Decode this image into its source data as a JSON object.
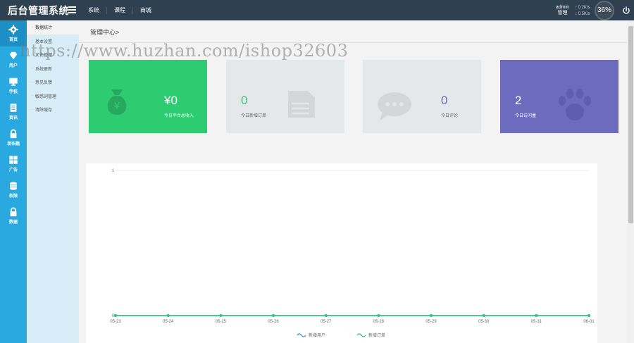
{
  "header": {
    "title": "后台管理系统",
    "nav": [
      "系统",
      "课程",
      "商城"
    ],
    "admin_name": "admin",
    "admin_role": "管理",
    "speed_up": "0.2K/s",
    "speed_down": "0.5K/s",
    "speed_percent": "36%"
  },
  "left_nav": [
    {
      "label": "首页",
      "icon": "gear-icon",
      "active": true
    },
    {
      "label": "用户",
      "icon": "diamond-icon",
      "active": false
    },
    {
      "label": "学校",
      "icon": "monitor-icon",
      "active": false
    },
    {
      "label": "资讯",
      "icon": "document-icon",
      "active": false
    },
    {
      "label": "发布题",
      "icon": "lock-icon",
      "active": false
    },
    {
      "label": "广告",
      "icon": "grid-icon",
      "active": false
    },
    {
      "label": "权限",
      "icon": "database-icon",
      "active": false
    },
    {
      "label": "数据",
      "icon": "lock-icon",
      "active": false
    }
  ],
  "submenu": [
    {
      "label": "数据统计",
      "active": true
    },
    {
      "label": "基本设置",
      "active": false
    },
    {
      "label": "文件管理",
      "active": false
    },
    {
      "label": "系统更新",
      "active": false
    },
    {
      "label": "意见反馈",
      "active": false
    },
    {
      "label": "敏感词管理",
      "active": false
    },
    {
      "label": "清除缓存",
      "active": false
    }
  ],
  "breadcrumb": "管理中心>",
  "cards": [
    {
      "value": "¥0",
      "label": "今日平台总收入",
      "icon": "money-bag-icon",
      "color": "#2ecc71"
    },
    {
      "value": "0",
      "label": "今日新增订单",
      "icon": "document-icon",
      "color": "#e5e8ea"
    },
    {
      "value": "0",
      "label": "今日评论",
      "icon": "chat-bubble-icon",
      "color": "#e5e8ea"
    },
    {
      "value": "2",
      "label": "今日访问量",
      "icon": "paw-icon",
      "color": "#6c6bbd"
    }
  ],
  "watermark": "https://www.huzhan.com/ishop32603",
  "chart_data": {
    "type": "line",
    "categories": [
      "05-23",
      "05-24",
      "05-25",
      "05-26",
      "05-27",
      "05-28",
      "05-29",
      "05-30",
      "05-31",
      "06-01"
    ],
    "series": [
      {
        "name": "新增用户",
        "values": [
          0,
          0,
          0,
          0,
          0,
          0,
          0,
          0,
          0,
          0
        ],
        "color": "#3b8fd9"
      },
      {
        "name": "新增订单",
        "values": [
          0,
          0,
          0,
          0,
          0,
          0,
          0,
          0,
          0,
          0
        ],
        "color": "#2ecc71"
      }
    ],
    "ylim": [
      0,
      1
    ],
    "yticks": [
      "0",
      "1"
    ],
    "grid": true,
    "legend": "bottom"
  }
}
